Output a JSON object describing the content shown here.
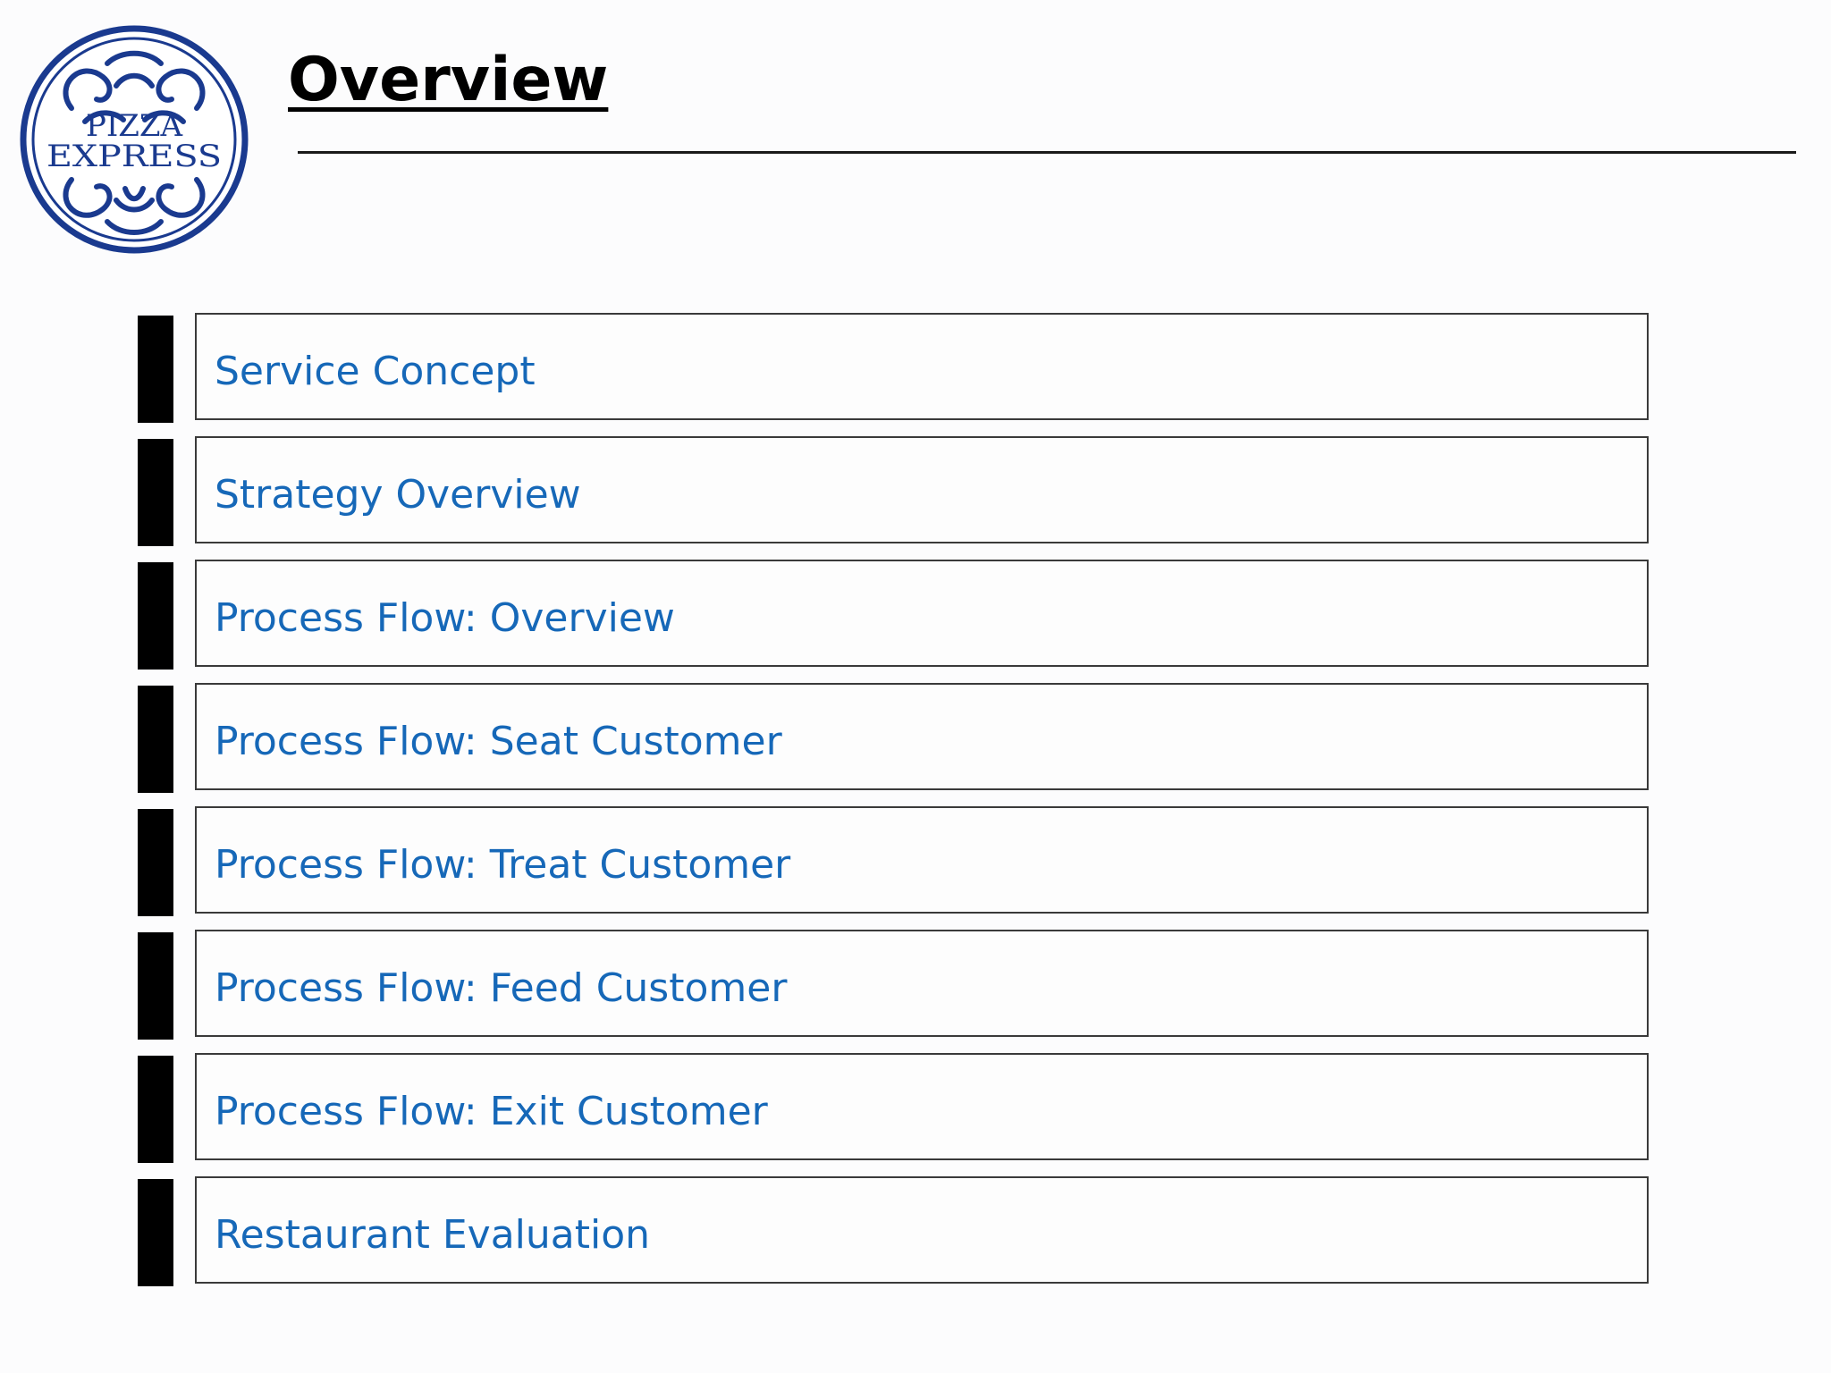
{
  "header": {
    "title": "Overview"
  },
  "logo": {
    "line1": "PIZZA",
    "line2": "EXPRESS",
    "color": "#1a3a8f"
  },
  "menu": {
    "items": [
      {
        "label": "Service Concept"
      },
      {
        "label": "Strategy Overview"
      },
      {
        "label": "Process Flow: Overview"
      },
      {
        "label": "Process Flow: Seat Customer"
      },
      {
        "label": "Process Flow: Treat Customer"
      },
      {
        "label": "Process Flow: Feed Customer"
      },
      {
        "label": "Process Flow: Exit Customer"
      },
      {
        "label": "Restaurant Evaluation"
      }
    ],
    "label_color": "#1668b8",
    "marker_color": "#000000"
  }
}
